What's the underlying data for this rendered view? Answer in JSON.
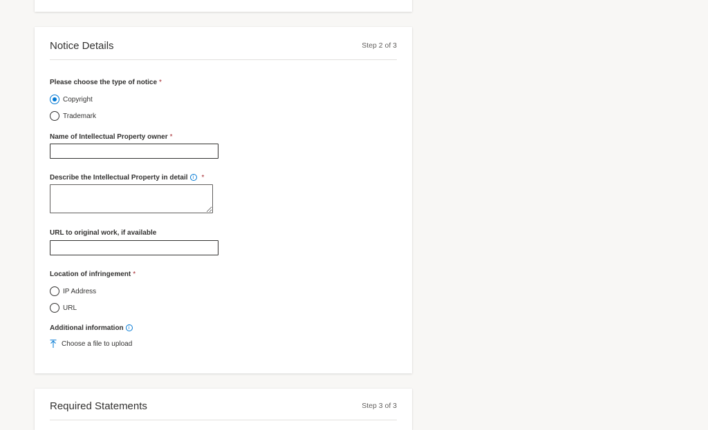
{
  "notice_details": {
    "title": "Notice Details",
    "step": "Step 2 of 3",
    "notice_type_label": "Please choose the type of notice",
    "notice_type_options": [
      {
        "label": "Copyright",
        "selected": true
      },
      {
        "label": "Trademark",
        "selected": false
      }
    ],
    "owner_label": "Name of Intellectual Property owner",
    "owner_value": "",
    "describe_label": "Describe the Intellectual Property in detail",
    "describe_value": "",
    "url_label": "URL to original work, if available",
    "url_value": "",
    "location_label": "Location of infringement",
    "location_options": [
      {
        "label": "IP Address",
        "selected": false
      },
      {
        "label": "URL",
        "selected": false
      }
    ],
    "additional_label": "Additional information",
    "upload_label": "Choose a file to upload",
    "required_marker": "*",
    "info_icon": "i"
  },
  "required_statements": {
    "title": "Required Statements",
    "step": "Step 3 of 3"
  },
  "colors": {
    "accent": "#0078d4",
    "required": "#a4262c",
    "background": "#f8f7f5"
  }
}
